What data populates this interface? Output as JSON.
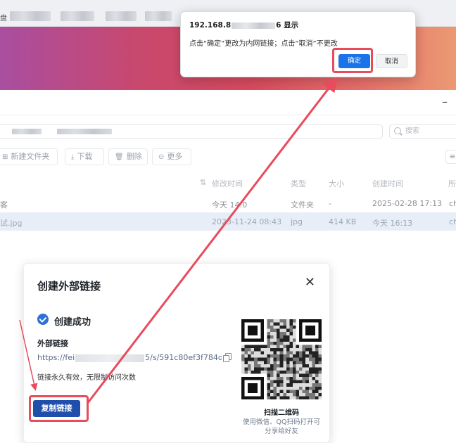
{
  "browser": {
    "tab_fragment": "盘"
  },
  "app": {
    "search_placeholder": "搜索",
    "toolbar": {
      "new_folder": "新建文件夹",
      "download": "下载",
      "delete": "删除",
      "more": "更多"
    },
    "columns": {
      "modified": "修改时间",
      "type": "类型",
      "size": "大小",
      "created": "创建时间",
      "owner_fragment": "所"
    },
    "rows": [
      {
        "name": "客",
        "modified": "今天 14:0",
        "type": "文件夹",
        "size": "-",
        "created": "2025-02-28 17:13",
        "owner": "ch"
      },
      {
        "name": "试.jpg",
        "modified": "2023-11-24 08:43",
        "type": "jpg",
        "size": "414 KB",
        "created": "今天 16:13",
        "owner": "ch"
      }
    ]
  },
  "dialog": {
    "title": "创建外部链接",
    "success_text": "创建成功",
    "link_label": "外部链接",
    "url_prefix": "https://fei",
    "url_suffix": "5/s/591c80ef3f784d1...",
    "permission_note": "链接永久有效，无限制访问次数",
    "copy_button": "复制链接",
    "qr_label": "扫描二维码",
    "qr_hint_line1": "使用微信、QQ扫码打开可",
    "qr_hint_line2": "分享给好友"
  },
  "alert": {
    "title_prefix": "192.168.8",
    "title_suffix": "6 显示",
    "message": "点击“确定”更改为内网链接；点击“取消”不更改",
    "ok_button": "确定",
    "cancel_button": "取消"
  },
  "colors": {
    "primary_button": "#1f4faa",
    "alert_ok": "#1a73e8",
    "annotation_red": "#e84b5c",
    "success_icon": "#2e6fd8"
  }
}
